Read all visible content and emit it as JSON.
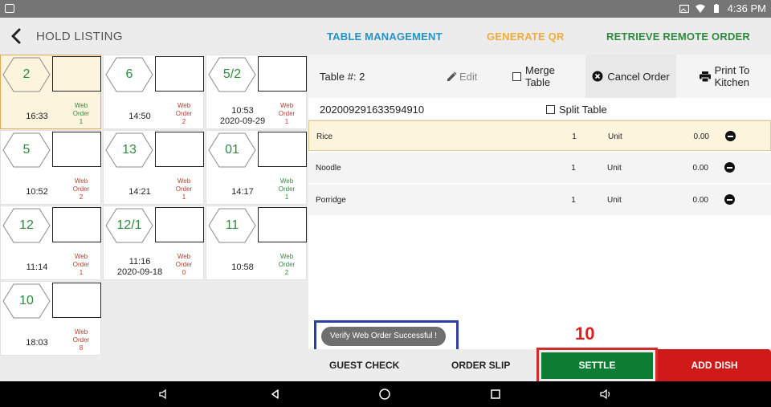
{
  "status_bar": {
    "time": "4:36 PM"
  },
  "header": {
    "title": "HOLD LISTING",
    "links": [
      {
        "label": "TABLE MANAGEMENT",
        "color": "#2493c9"
      },
      {
        "label": "GENERATE QR",
        "color": "#f0ac3a"
      },
      {
        "label": "RETRIEVE REMOTE ORDER",
        "color": "#2e8b3e"
      }
    ]
  },
  "tables": [
    {
      "number": "2",
      "time": "16:33",
      "date": "",
      "web": "Web",
      "order": "Order",
      "count": "1",
      "web_color": "green",
      "selected": true
    },
    {
      "number": "6",
      "time": "14:50",
      "date": "",
      "web": "Web",
      "order": "Order",
      "count": "2",
      "web_color": "red",
      "selected": false
    },
    {
      "number": "5/2",
      "time": "10:53",
      "date": "2020-09-29",
      "web": "Web",
      "order": "Order",
      "count": "1",
      "web_color": "red",
      "selected": false
    },
    {
      "number": "5",
      "time": "10:52",
      "date": "",
      "web": "Web",
      "order": "Order",
      "count": "2",
      "web_color": "red",
      "selected": false
    },
    {
      "number": "13",
      "time": "14:21",
      "date": "",
      "web": "Web",
      "order": "Order",
      "count": "1",
      "web_color": "red",
      "selected": false
    },
    {
      "number": "01",
      "time": "14:17",
      "date": "",
      "web": "Web",
      "order": "Order",
      "count": "1",
      "web_color": "green",
      "selected": false
    },
    {
      "number": "12",
      "time": "11:14",
      "date": "",
      "web": "Web",
      "order": "Order",
      "count": "1",
      "web_color": "red",
      "selected": false
    },
    {
      "number": "12/1",
      "time": "11:16",
      "date": "2020-09-18",
      "web": "Web",
      "order": "Order",
      "count": "0",
      "web_color": "red",
      "selected": false
    },
    {
      "number": "11",
      "time": "10:58",
      "date": "",
      "web": "Web",
      "order": "Order",
      "count": "2",
      "web_color": "green",
      "selected": false
    },
    {
      "number": "10",
      "time": "18:03",
      "date": "",
      "web": "Web",
      "order": "Order",
      "count": "8",
      "web_color": "red",
      "selected": false
    }
  ],
  "order_panel": {
    "table_label": "Table #: 2",
    "edit_label": "Edit",
    "merge_label_1": "Merge",
    "merge_label_2": "Table",
    "cancel_label": "Cancel Order",
    "print_label_1": "Print To",
    "print_label_2": "Kitchen",
    "order_number": "202009291633594910",
    "split_label": "Split Table",
    "items": [
      {
        "name": "Rice",
        "qty": "1",
        "unit": "Unit",
        "price": "0.00"
      },
      {
        "name": "Noodle",
        "qty": "1",
        "unit": "Unit",
        "price": "0.00"
      },
      {
        "name": "Porridge",
        "qty": "1",
        "unit": "Unit",
        "price": "0.00"
      }
    ]
  },
  "toast": {
    "message": "Verify Web Order Successful !"
  },
  "annotation": {
    "step": "10"
  },
  "actions": {
    "guest_check": "GUEST CHECK",
    "order_slip": "ORDER SLIP",
    "settle": "SETTLE",
    "add_dish": "ADD DISH"
  },
  "colors": {
    "accent_green": "#0d7d33",
    "accent_red": "#d01919",
    "selected_bg": "#fdf4de",
    "highlight_frame_blue": "#2d3ea8",
    "highlight_frame_red": "#d42a2a"
  }
}
